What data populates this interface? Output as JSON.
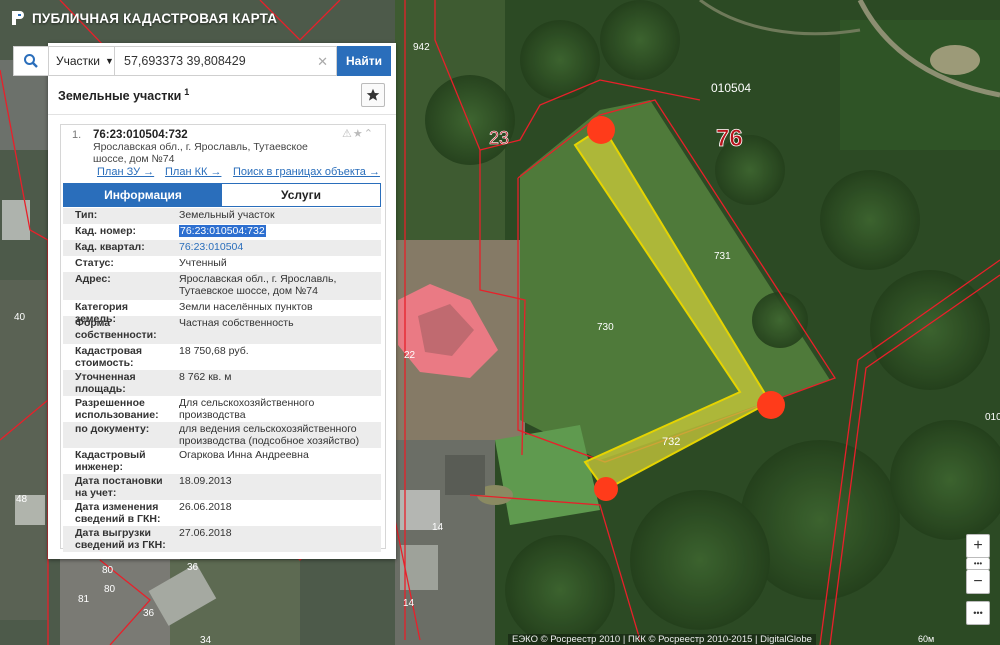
{
  "app": {
    "title": "ПУБЛИЧНАЯ КАДАСТРОВАЯ КАРТА"
  },
  "search": {
    "type_label": "Участки",
    "query": "57,693373 39,808429",
    "find_label": "Найти"
  },
  "panel": {
    "title": "Земельные участки",
    "count": "1"
  },
  "parcel": {
    "index": "1.",
    "id": "76:23:010504:732",
    "address": "Ярославская обл., г. Ярославль, Тутаевское шоссе, дом №74",
    "links": [
      "План ЗУ →",
      "План КК →",
      "Поиск в границах объекта →"
    ],
    "tabs": [
      "Информация",
      "Услуги"
    ],
    "info": [
      {
        "k": "Тип:",
        "v": "Земельный участок"
      },
      {
        "k": "Кад. номер:",
        "v": "76:23:010504:732"
      },
      {
        "k": "Кад. квартал:",
        "v": "76:23:010504"
      },
      {
        "k": "Статус:",
        "v": "Учтенный"
      },
      {
        "k": "Адрес:",
        "v": "Ярославская обл., г. Ярославль, Тутаевское шоссе, дом №74"
      },
      {
        "k": "Категория земель:",
        "v": "Земли населённых пунктов"
      },
      {
        "k": "Форма собственности:",
        "v": "Частная собственность"
      },
      {
        "k": "Кадастровая стоимость:",
        "v": "18 750,68 руб."
      },
      {
        "k": "Уточненная площадь:",
        "v": "8 762 кв. м"
      },
      {
        "k": "Разрешенное использование:",
        "v": "Для сельскохозяйственного производства"
      },
      {
        "k": "по документу:",
        "v": "для ведения сельскохозяйственного производства (подсобное хозяйство)"
      },
      {
        "k": "Кадастровый инженер:",
        "v": "Огаркова Инна Андреевна"
      },
      {
        "k": "Дата постановки на учет:",
        "v": "18.09.2013"
      },
      {
        "k": "Дата изменения сведений в ГКН:",
        "v": "26.06.2018"
      },
      {
        "k": "Дата выгрузки сведений из ГКН:",
        "v": "27.06.2018"
      }
    ]
  },
  "map_labels": {
    "quarter_010504": "010504",
    "district_76": "76",
    "district_23": "23",
    "lot_732": "732",
    "lot_731": "731",
    "lot_730": "730",
    "lot_942": "942",
    "n22": "22",
    "n14a": "14",
    "n14b": "14",
    "n40": "40",
    "n48": "48",
    "n80a": "80",
    "n80b": "80",
    "n81": "81",
    "n36a": "36",
    "n36b": "36",
    "n34": "34",
    "n010": "010"
  },
  "controls": {
    "zoom_in": "+",
    "more": "•••",
    "zoom_out": "−",
    "extra": "•••"
  },
  "footer": {
    "copyright": "ЕЭКО © Росреестр 2010 | ПКК © Росреестр 2010-2015 | DigitalGlobe",
    "scale": "60м"
  },
  "colors": {
    "accent": "#2a6ebb",
    "parcel_fill": "#c8c83a",
    "parcel_border": "#e6d400",
    "vertex": "#ff3b1a",
    "boundary": "#e8202a"
  }
}
